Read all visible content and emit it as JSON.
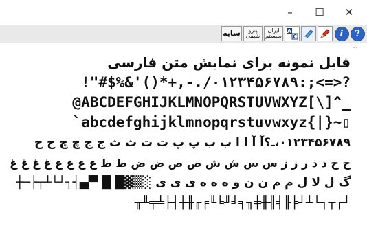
{
  "window": {
    "minimize": "–",
    "maximize": "☐",
    "close": "✕"
  },
  "toolbar": {
    "help_label": "?",
    "info_label": "i",
    "ac_label": "A C",
    "iran_system_label": "ایران سیستم",
    "petro_chemical_label": "پترو شیمی",
    "shadow_label": "سایه"
  },
  "content": {
    "lines": [
      "فایل نمونه برای نمایش متن فارسی",
      "!\"#$%&'()*+,-./۰۱۲۳۴۵۶۷۸۹:;<=>?",
      "@ABCDEFGHIJKLMNOPQRSTUVWXYZ[\\]^_",
      "`abcdefghijklmnopqrstuvwxyz{|}~▯",
      "۰۱۲۳۴۵۶۷۸۹،ـ؟آ آ ا ا ب ب پ پ ت ت ث ث ج ج چ چ ح ح",
      "خ خ د ذ ر ز ژ س س ش ش ص ص ض ض ط ظ ع ع ع ع غ غ غ غ ف ف ق ق ک ک گ گ",
      "گ ل لا ل م م ن ن و ه ه ه ی ی ی ░▒▓█▌▐▀▄┤┐┘└┴┬├─┼",
      "┘┌┬┐└┴┘╞╟╡╢╫╪╖╕╛╜╘╙╒╓╫┼┤├╧╤╨╥"
    ]
  }
}
